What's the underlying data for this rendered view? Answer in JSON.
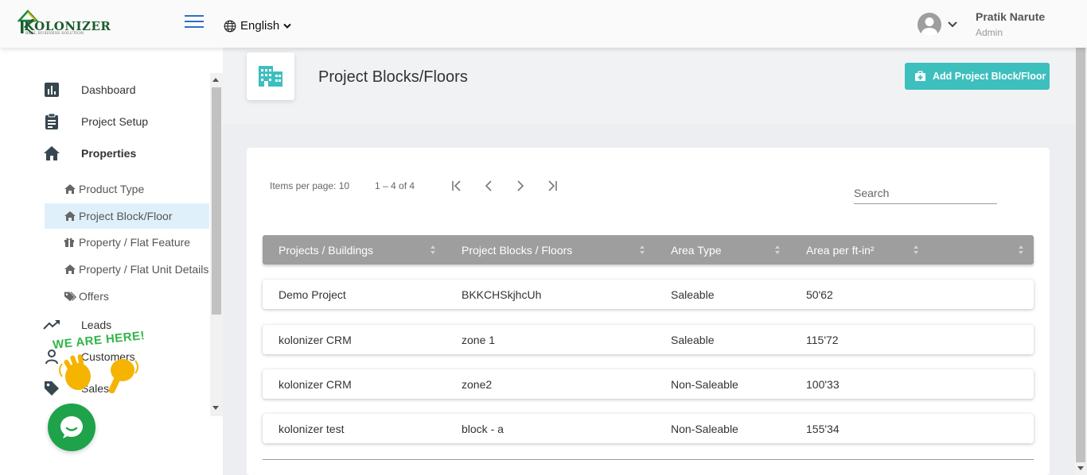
{
  "header": {
    "logo_text": "KOLONIZER",
    "logo_tagline": "REAL BUSINESS SOLUTION",
    "language": "English",
    "user_name": "Pratik Narute",
    "user_role": "Admin"
  },
  "sidebar": {
    "items": [
      {
        "label": "Dashboard",
        "icon": "chart-icon"
      },
      {
        "label": "Project Setup",
        "icon": "clipboard-icon"
      },
      {
        "label": "Properties",
        "icon": "home-icon"
      },
      {
        "label": "Leads",
        "icon": "trending-up-icon"
      },
      {
        "label": "Customers",
        "icon": "person-icon"
      },
      {
        "label": "Sales",
        "icon": "tag-icon"
      }
    ],
    "sub_items": [
      {
        "label": "Product Type",
        "icon": "home-icon"
      },
      {
        "label": "Project Block/Floor",
        "icon": "home-icon"
      },
      {
        "label": "Property / Flat Feature",
        "icon": "gift-icon"
      },
      {
        "label": "Property / Flat Unit Details",
        "icon": "home-icon"
      },
      {
        "label": "Offers",
        "icon": "tags-icon"
      }
    ],
    "promo_text": "WE ARE HERE!"
  },
  "page": {
    "title": "Project Blocks/Floors",
    "add_button": "Add Project Block/Floor"
  },
  "paginator": {
    "items_per_page_label": "Items per page:",
    "items_per_page": "10",
    "range": "1 – 4 of 4"
  },
  "search": {
    "placeholder": "Search"
  },
  "table": {
    "columns": [
      "Projects / Buildings",
      "Project Blocks / Floors",
      "Area Type",
      "Area per ft-in²"
    ],
    "rows": [
      [
        "Demo Project",
        "BKKCHSkjhcUh",
        "Saleable",
        "50'62"
      ],
      [
        "kolonizer CRM",
        "zone 1",
        "Saleable",
        "115'72"
      ],
      [
        "kolonizer CRM",
        "zone2",
        "Non-Saleable",
        "100'33"
      ],
      [
        "kolonizer test",
        "block - a",
        "Non-Saleable",
        "155'34"
      ]
    ]
  },
  "colors": {
    "accent": "#3dbfbe",
    "header_row": "#9e9e9e",
    "active_sub_item": "#dff0fa",
    "chat": "#1ea34b",
    "logo_green": "#1a5c2e"
  }
}
